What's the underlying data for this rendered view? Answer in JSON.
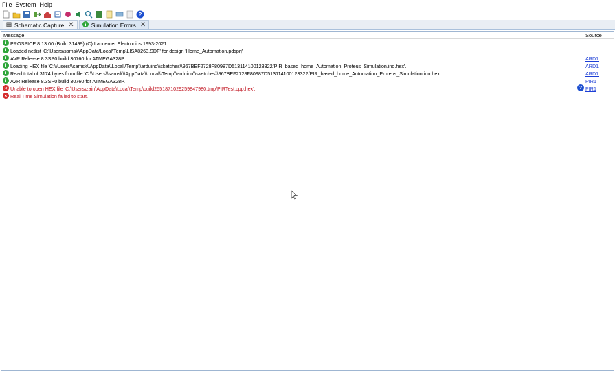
{
  "menu": {
    "file": "File",
    "system": "System",
    "help": "Help"
  },
  "toolbar": {
    "icons": [
      "new-file-icon",
      "open-folder-icon",
      "save-icon",
      "import-icon",
      "home-icon",
      "schematic-icon",
      "component-icon",
      "sound-icon",
      "search-icon",
      "document-icon",
      "export-icon",
      "bom-icon",
      "notes-icon",
      "help-icon"
    ]
  },
  "tabs": [
    {
      "label": "Schematic Capture",
      "active": false
    },
    {
      "label": "Simulation Errors",
      "active": true
    }
  ],
  "table": {
    "col_message": "Message",
    "col_source": "Source",
    "rows": [
      {
        "type": "info",
        "message": "PROSPICE 8.13.00 (Build 31499) (C) Labcenter Electronics 1993-2021.",
        "source": ""
      },
      {
        "type": "info",
        "message": "Loaded netlist 'C:\\Users\\samsk\\AppData\\Local\\Temp\\LISA8263.SDF' for design 'Home_Automation.pdsprj'",
        "source": ""
      },
      {
        "type": "info",
        "message": "AVR Release 8.3SP0 build 30760 for ATMEGA328P.",
        "source": "ARD1"
      },
      {
        "type": "info",
        "message": "Loading HEX file 'C:\\\\Users\\\\samsk\\\\AppData\\\\Local\\\\Temp\\\\arduino\\\\sketches\\\\967BEF2728F80987D513114100123322/PIR_based_home_Automation_Proteus_Simulation.ino.hex'.",
        "source": "ARD1"
      },
      {
        "type": "info",
        "message": "Read total of 3174 bytes from file 'C:\\\\Users\\\\samsk\\\\AppData\\\\Local\\\\Temp\\\\arduino\\\\sketches\\\\967BEF2728F80987D513114100123322/PIR_based_home_Automation_Proteus_Simulation.ino.hex'.",
        "source": "ARD1"
      },
      {
        "type": "info",
        "message": "AVR Release 8.3SP0 build 30760 for ATMEGA328P.",
        "source": "PIR1"
      },
      {
        "type": "error",
        "message": "Unable to open HEX file 'C:\\Users\\zain\\AppData\\Local\\Temp\\build2551871029259847980.tmp/PIRTest.cpp.hex'.",
        "source": "PIR1",
        "help": "?"
      },
      {
        "type": "error",
        "message": "Real Time Simulation failed to start.",
        "source": ""
      }
    ]
  }
}
